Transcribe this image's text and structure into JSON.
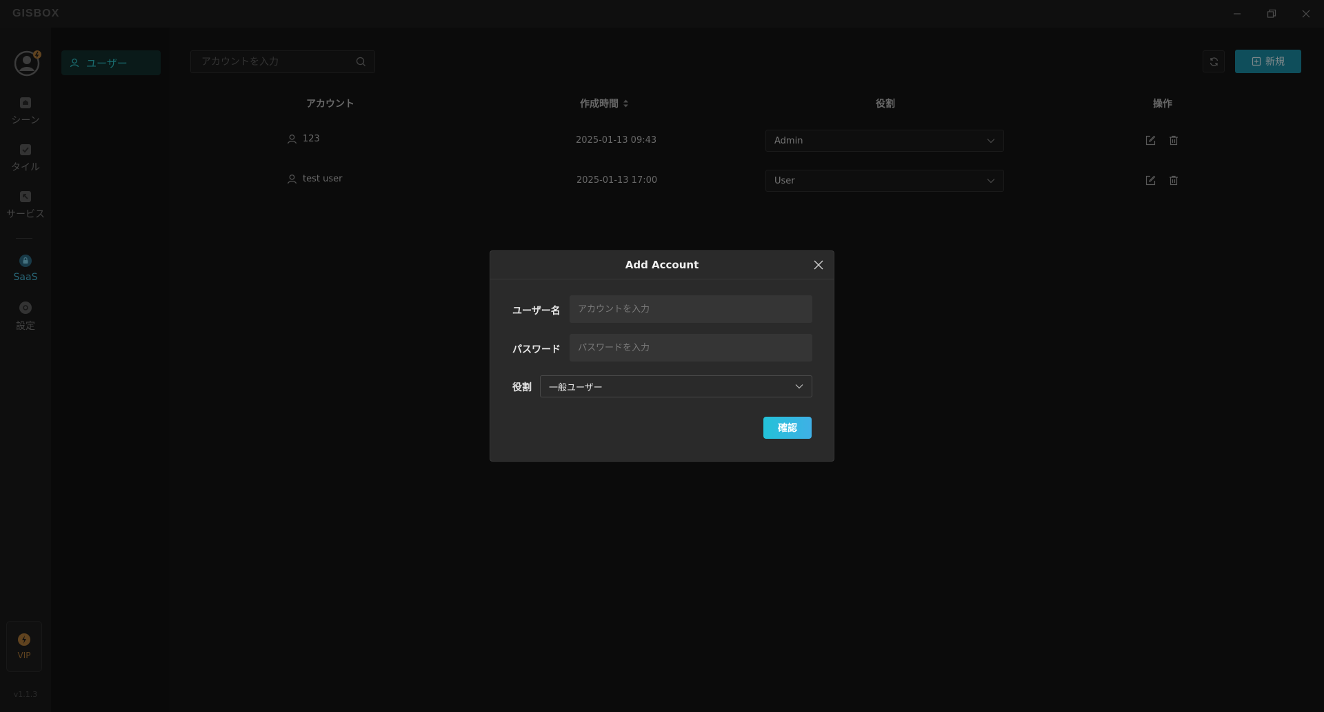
{
  "app": {
    "logo": "GISBOX"
  },
  "colors": {
    "accent": "#2fc4c8",
    "primary": "#1c8fa6",
    "vip": "#b07a3a"
  },
  "rail": {
    "items": [
      {
        "label": "シーン",
        "icon": "scene-icon"
      },
      {
        "label": "タイル",
        "icon": "tile-icon"
      },
      {
        "label": "サービス",
        "icon": "service-icon"
      },
      {
        "label": "SaaS",
        "icon": "saas-icon"
      },
      {
        "label": "設定",
        "icon": "settings-icon"
      }
    ],
    "vip": "VIP",
    "version": "v1.1.3"
  },
  "subnav": {
    "users": "ユーザー"
  },
  "toolbar": {
    "search_placeholder": "アカウントを入力",
    "new_label": "新規"
  },
  "table": {
    "headers": {
      "account": "アカウント",
      "created": "作成時間",
      "role": "役割",
      "actions": "操作"
    },
    "rows": [
      {
        "account": "123",
        "created": "2025-01-13 09:43",
        "role": "Admin"
      },
      {
        "account": "test user",
        "created": "2025-01-13 17:00",
        "role": "User"
      }
    ]
  },
  "modal": {
    "title": "Add Account",
    "username_label": "ユーザー名",
    "username_placeholder": "アカウントを入力",
    "password_label": "パスワード",
    "password_placeholder": "パスワードを入力",
    "role_label": "役割",
    "role_value": "一般ユーザー",
    "confirm_label": "確認"
  }
}
